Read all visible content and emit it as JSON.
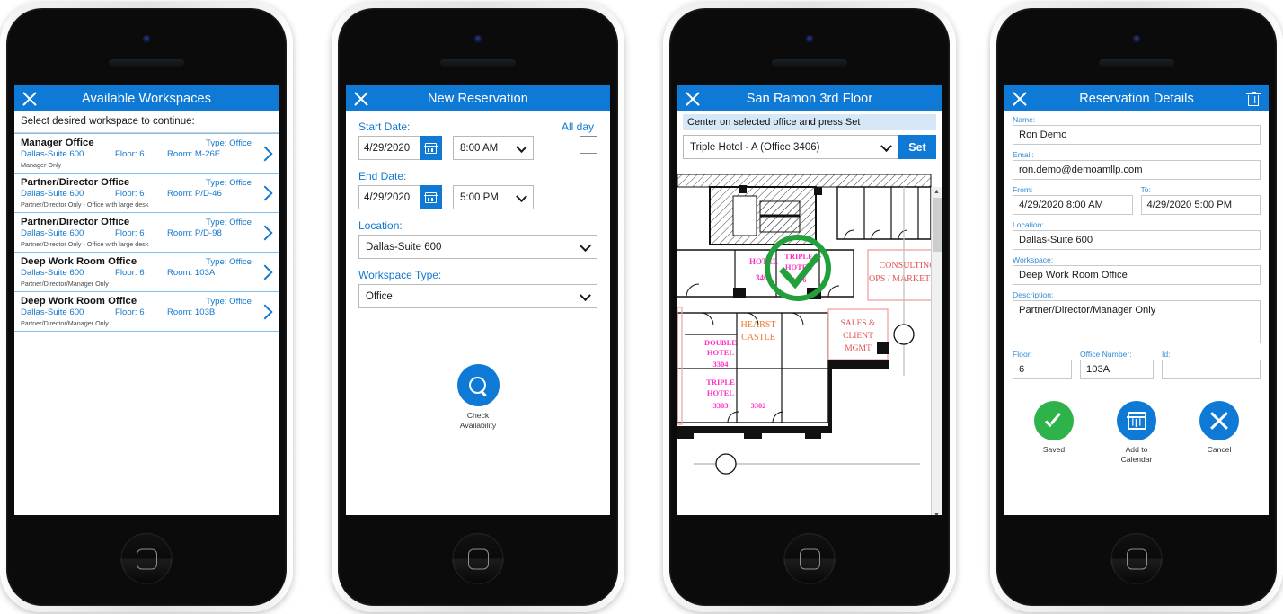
{
  "phone1": {
    "header": {
      "title": "Available Workspaces",
      "close_icon": "close-icon"
    },
    "hint": "Select desired workspace to continue:",
    "rows": [
      {
        "name": "Manager Office",
        "type": "Type: Office",
        "location": "Dallas-Suite 600",
        "floor": "Floor: 6",
        "room": "Room: M-26E",
        "desc": "Manager Only"
      },
      {
        "name": "Partner/Director Office",
        "type": "Type: Office",
        "location": "Dallas-Suite 600",
        "floor": "Floor: 6",
        "room": "Room: P/D-46",
        "desc": "Partner/Director Only - Office with large desk"
      },
      {
        "name": "Partner/Director Office",
        "type": "Type: Office",
        "location": "Dallas-Suite 600",
        "floor": "Floor: 6",
        "room": "Room: P/D-98",
        "desc": "Partner/Director Only - Office with large desk"
      },
      {
        "name": "Deep Work Room Office",
        "type": "Type: Office",
        "location": "Dallas-Suite 600",
        "floor": "Floor: 6",
        "room": "Room: 103A",
        "desc": "Partner/Director/Manager Only"
      },
      {
        "name": "Deep Work Room Office",
        "type": "Type: Office",
        "location": "Dallas-Suite 600",
        "floor": "Floor: 6",
        "room": "Room: 103B",
        "desc": "Partner/Director/Manager Only"
      }
    ]
  },
  "phone2": {
    "header": {
      "title": "New Reservation",
      "close_icon": "close-icon"
    },
    "start_date_label": "Start Date:",
    "start_date_value": "4/29/2020",
    "start_time_value": "8:00 AM",
    "all_day_label": "All day",
    "all_day_checked": false,
    "end_date_label": "End Date:",
    "end_date_value": "4/29/2020",
    "end_time_value": "5:00 PM",
    "location_label": "Location:",
    "location_value": "Dallas-Suite 600",
    "workspace_type_label": "Workspace Type:",
    "workspace_type_value": "Office",
    "check_button_line1": "Check",
    "check_button_line2": "Availability",
    "search_icon": "search-icon"
  },
  "phone3": {
    "header": {
      "title": "San Ramon 3rd Floor",
      "close_icon": "close-icon"
    },
    "hint": "Center on selected office and press Set",
    "office_select_value": "Triple Hotel - A (Office 3406)",
    "set_label": "Set",
    "map": {
      "rooms": [
        {
          "label": "HOTEL",
          "number": "3405",
          "color": "#ff2ec4"
        },
        {
          "label": "TRIPLE HOTEL",
          "number": "3406",
          "color": "#ff2ec4",
          "selected": true
        },
        {
          "label": "CONSULTING OPS / MARKETING",
          "color": "#f06a6a"
        },
        {
          "label": "HEARST CASTLE",
          "color": "#e8762c"
        },
        {
          "label": "SALES & CLIENT MGMT",
          "color": "#f06a6a"
        },
        {
          "label": "DOUBLE HOTEL",
          "number": "3304",
          "color": "#ff2ec4"
        },
        {
          "label": "TRIPLE HOTEL",
          "number": "3303",
          "color": "#ff2ec4"
        },
        {
          "label": "",
          "number": "3302",
          "color": "#ff2ec4"
        }
      ],
      "selection_marker_color": "#22a03c"
    }
  },
  "phone4": {
    "header": {
      "title": "Reservation Details",
      "close_icon": "close-icon",
      "delete_icon": "trash-icon"
    },
    "fields": [
      {
        "label": "Name:",
        "value": "Ron Demo"
      },
      {
        "label": "Email:",
        "value": "ron.demo@demoamllp.com"
      }
    ],
    "from_label": "From:",
    "from_value": "4/29/2020 8:00 AM",
    "to_label": "To:",
    "to_value": "4/29/2020 5:00 PM",
    "location_label": "Location:",
    "location_value": "Dallas-Suite 600",
    "workspace_label": "Workspace:",
    "workspace_value": "Deep Work Room Office",
    "description_label": "Description:",
    "description_value": "Partner/Director/Manager Only",
    "floor_label": "Floor:",
    "floor_value": "6",
    "office_number_label": "Office Number:",
    "office_number_value": "103A",
    "id_label": "Id:",
    "id_value": "",
    "actions": [
      {
        "label": "Saved",
        "icon": "check-icon",
        "color": "#2db34a"
      },
      {
        "label": "Add to Calendar",
        "label_line1": "Add to",
        "label_line2": "Calendar",
        "icon": "calendar-icon",
        "color": "#0f7ad6"
      },
      {
        "label": "Cancel",
        "icon": "close-icon",
        "color": "#0f7ad6"
      }
    ]
  },
  "theme": {
    "accent": "#0f7ad6",
    "link": "#1478cd",
    "green": "#2db34a",
    "hint_bg": "#d6e8f8"
  }
}
